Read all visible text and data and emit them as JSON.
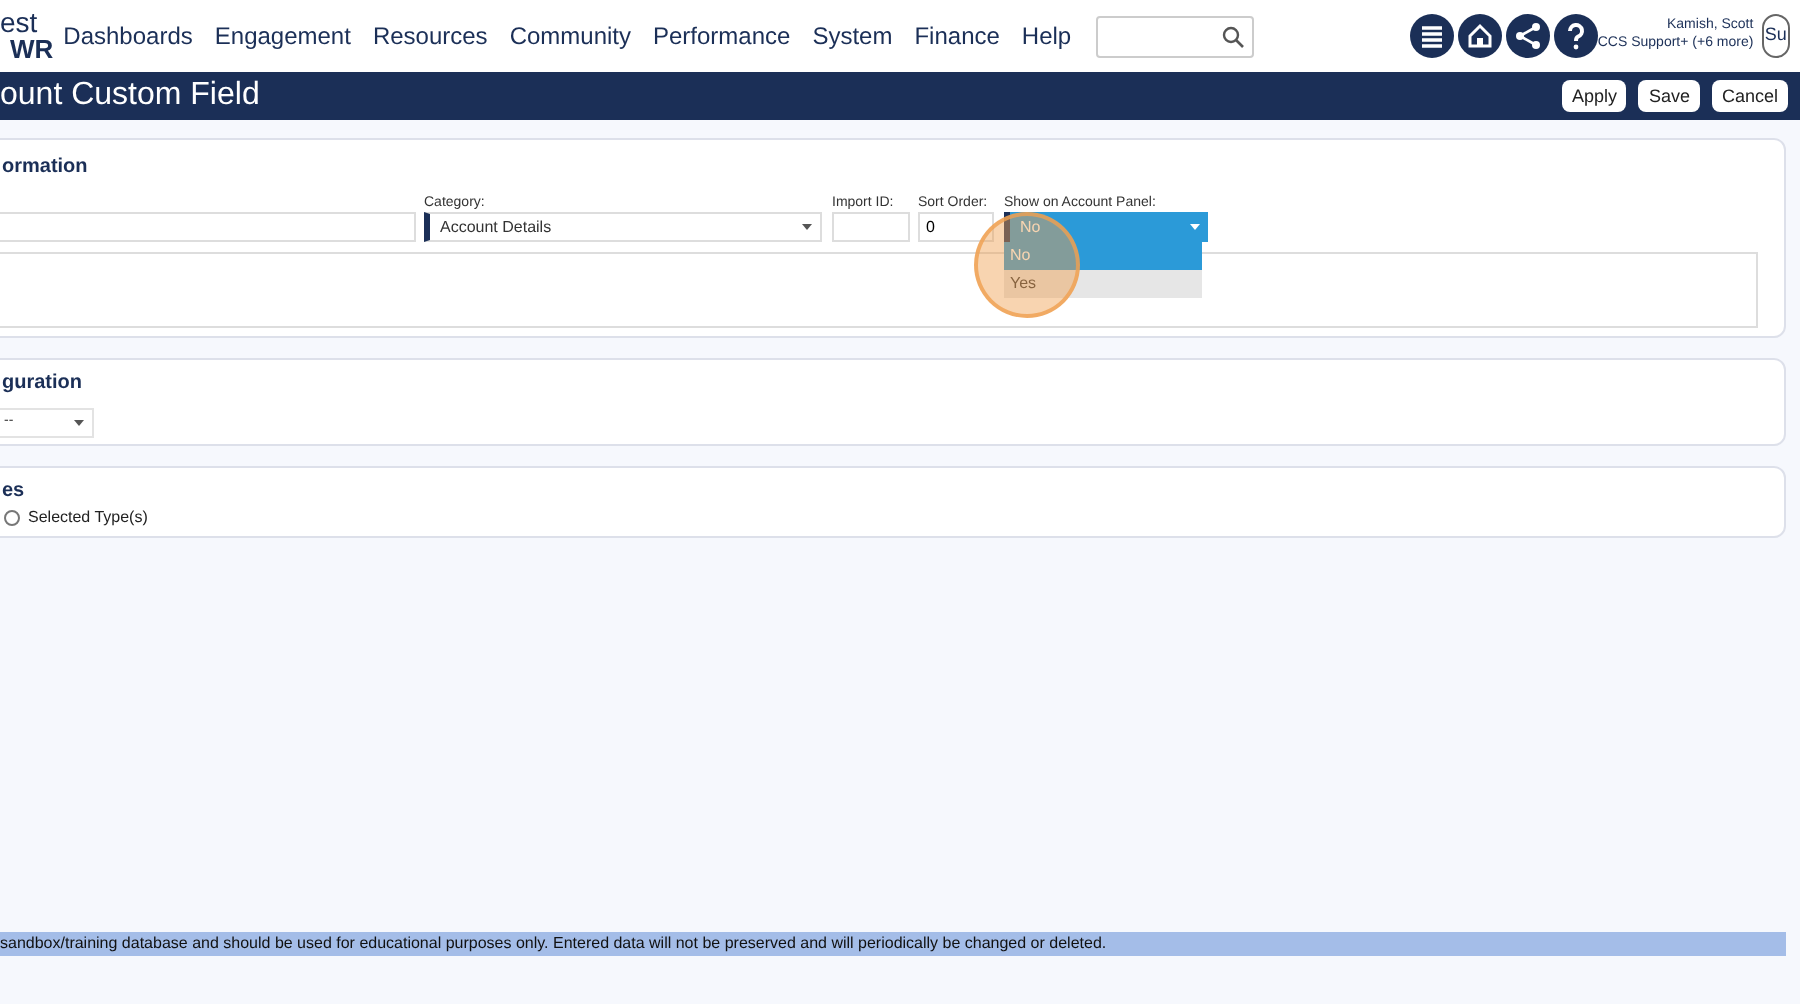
{
  "logo": {
    "line_1": "est",
    "line_2": "WR"
  },
  "nav": [
    {
      "label": "Dashboards"
    },
    {
      "label": "Engagement"
    },
    {
      "label": "Resources"
    },
    {
      "label": "Community"
    },
    {
      "label": "Performance"
    },
    {
      "label": "System"
    },
    {
      "label": "Finance"
    },
    {
      "label": "Help"
    }
  ],
  "user": {
    "name": "Kamish, Scott",
    "role": "CCS Support+ (+6 more)",
    "avatar_text": "Su"
  },
  "title_bar": {
    "title": "ount Custom Field",
    "buttons": [
      {
        "label": "Apply"
      },
      {
        "label": "Save"
      },
      {
        "label": "Cancel"
      }
    ]
  },
  "information_panel": {
    "heading": "ormation",
    "category": {
      "label": "Category:",
      "value": "Account Details"
    },
    "import_id": {
      "label": "Import ID:"
    },
    "sort_order": {
      "label": "Sort Order:",
      "value": "0"
    },
    "show_on_account_panel": {
      "label": "Show on Account Panel:",
      "value": "No",
      "expanded": true,
      "options": [
        {
          "label": "No",
          "selected": true,
          "hovered": false
        },
        {
          "label": "Yes",
          "selected": false,
          "hovered": true
        }
      ]
    }
  },
  "configuration_panel": {
    "heading": "guration",
    "select_value": "--"
  },
  "types_panel": {
    "heading": "es",
    "radios": [
      {
        "label": "Selected Type(s)",
        "checked": false
      }
    ]
  },
  "footer_notice": "sandbox/training database and should be used for educational purposes only. Entered data will not be preserved and will periodically be changed or deleted."
}
